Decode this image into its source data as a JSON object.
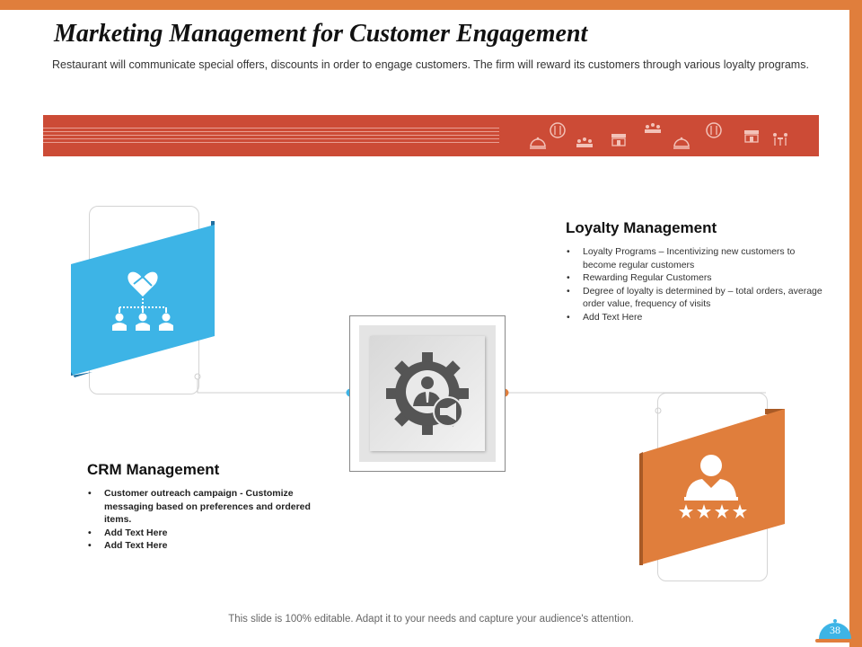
{
  "slide": {
    "title": "Marketing Management for Customer Engagement",
    "subtitle": "Restaurant will communicate special offers, discounts in order to engage customers. The firm will  reward its customers through various loyalty programs."
  },
  "banner": {
    "color": "#cc4b36",
    "icons": [
      "cloche-icon",
      "plate-cutlery-icon",
      "team-icon",
      "restaurant-storefront-icon",
      "team-icon",
      "cloche-icon",
      "plate-cutlery-icon",
      "restaurant-storefront-icon",
      "dining-table-icon"
    ]
  },
  "loyalty": {
    "title": "Loyalty Management",
    "items": [
      "Loyalty Programs – Incentivizing new customers to become regular customers",
      "Rewarding Regular Customers",
      "Degree of loyalty is determined by – total orders, average order value, frequency of visits",
      "Add Text Here"
    ],
    "icon": "customer-rating-icon",
    "color": "#e07e3c"
  },
  "crm": {
    "title": "CRM Management",
    "items": [
      "Customer outreach campaign - Customize messaging based on preferences and ordered items.",
      "Add  Text Here",
      "Add  Text Here"
    ],
    "icon": "handshake-network-icon",
    "color": "#3db4e6"
  },
  "center": {
    "icon": "gear-marketing-icon"
  },
  "footer": {
    "text": "This slide is 100% editable. Adapt it to your needs and capture your audience's attention.",
    "page_number": "38"
  },
  "colors": {
    "accent_orange": "#e07e3c",
    "accent_blue": "#3db4e6",
    "banner_red": "#cc4b36"
  }
}
